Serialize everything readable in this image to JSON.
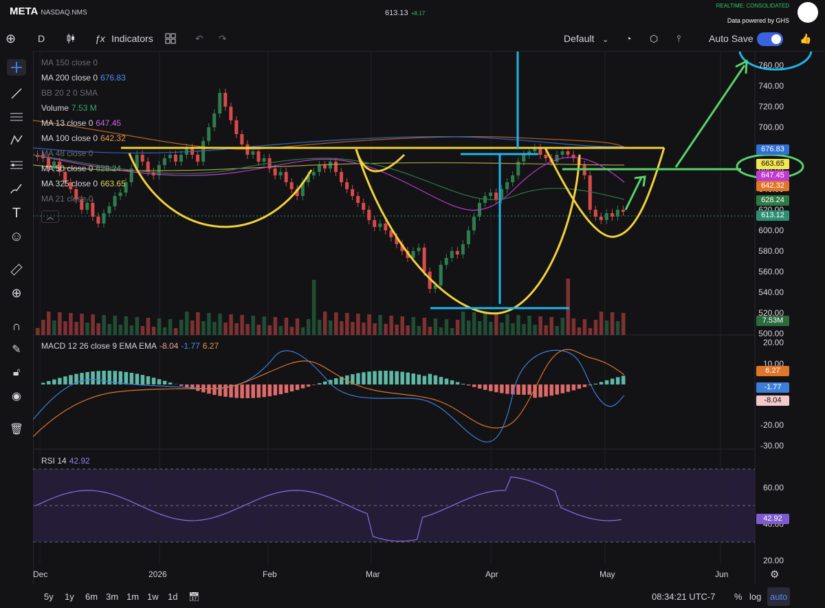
{
  "header": {
    "symbol": "META",
    "exchange": "NASDAQ.NMS",
    "price": "613.13",
    "change": "+8.17",
    "realtime": "REALTIME: CONSOLIDATED",
    "data_powered_by": "Data powered by",
    "provider": "GHS"
  },
  "toolbar": {
    "interval": "D",
    "indicators_label": "Indicators",
    "layout_name": "Default",
    "autosave_label": "Auto Save",
    "autosave_on": true
  },
  "legend": {
    "ma150": "MA 150 close 0",
    "ma200": "MA 200 close 0",
    "ma200_val": "676.83",
    "bb": "BB 20 2 0 SMA",
    "volume": "Volume",
    "volume_val": "7.53 M",
    "ma13": "MA 13 close 0",
    "ma13_val": "647.45",
    "ma100": "MA 100 close 0",
    "ma100_val": "642.32",
    "ma48": "MA 48 close 0",
    "ma50": "MA 50 close 0",
    "ma50_val": "628.24",
    "ma325": "MA 325 close 0",
    "ma325_val": "663.65",
    "ma21": "MA 21 close 0"
  },
  "price_axis": [
    "760.00",
    "740.00",
    "720.00",
    "700.00",
    "680.00",
    "660.00",
    "640.00",
    "620.00",
    "600.00",
    "580.00",
    "560.00",
    "540.00",
    "520.00",
    "500.00"
  ],
  "price_tags": [
    {
      "label": "676.83",
      "bg": "#2f6fd6",
      "fg": "#ffffff"
    },
    {
      "label": "663.65",
      "bg": "#f3e552",
      "fg": "#111111"
    },
    {
      "label": "647.45",
      "bg": "#c03ad1",
      "fg": "#ffffff"
    },
    {
      "label": "642.32",
      "bg": "#e0762a",
      "fg": "#ffffff"
    },
    {
      "label": "628.24",
      "bg": "#2d7a42",
      "fg": "#ffffff"
    },
    {
      "label": "613.12",
      "bg": "#2c8f72",
      "fg": "#ffffff"
    },
    {
      "label": "7.53M",
      "bg": "#2d6b3c",
      "fg": "#ffffff"
    }
  ],
  "macd": {
    "label": "MACD 12 26 close 9 EMA EMA",
    "hist": "-8.04",
    "macd": "-1.77",
    "signal": "6.27",
    "axis": [
      "20.00",
      "10.00",
      "-20.00",
      "-30.00"
    ],
    "tags": [
      {
        "label": "6.27",
        "bg": "#e0762a",
        "fg": "#ffffff"
      },
      {
        "label": "-1.77",
        "bg": "#3d7fd8",
        "fg": "#ffffff"
      },
      {
        "label": "-8.04",
        "bg": "#f3c9c9",
        "fg": "#111111"
      }
    ]
  },
  "rsi": {
    "label": "RSI 14",
    "value": "42.92",
    "axis": [
      "60.00",
      "40.00",
      "20.00"
    ],
    "tag": {
      "label": "42.92",
      "bg": "#7d5bd0",
      "fg": "#ffffff"
    }
  },
  "x_axis": [
    "Dec",
    "2026",
    "Feb",
    "Mar",
    "Apr",
    "May",
    "Jun"
  ],
  "bottom": {
    "ranges": [
      "5y",
      "1y",
      "6m",
      "3m",
      "1m",
      "1w",
      "1d"
    ],
    "time": "08:34:21 UTC-7",
    "pct": "%",
    "log": "log",
    "auto": "auto"
  },
  "colors": {
    "up": "#2e7d4f",
    "down": "#d94a4a",
    "annotation_yellow": "#f2d23a",
    "annotation_blue": "#1fb5e8",
    "annotation_green": "#58d26b"
  }
}
